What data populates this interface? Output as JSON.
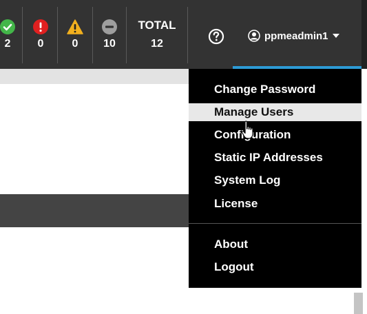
{
  "status": {
    "ok": {
      "icon": "check-circle-icon",
      "count": "2",
      "color": "#43b649"
    },
    "critical": {
      "icon": "exclamation-circle-icon",
      "count": "0",
      "color": "#e02020"
    },
    "warning": {
      "icon": "warning-triangle-icon",
      "count": "0",
      "color": "#f2b01e"
    },
    "disabled": {
      "icon": "minus-circle-icon",
      "count": "10",
      "color": "#9e9e9e"
    },
    "total": {
      "label": "TOTAL",
      "count": "12"
    }
  },
  "header": {
    "help_icon": "question-circle-icon",
    "user_icon": "user-circle-icon",
    "username": "ppmeadmin1",
    "accent_color": "#2d9bd6"
  },
  "user_menu": {
    "items": [
      {
        "label": "Change Password"
      },
      {
        "label": "Manage Users",
        "hovered": true
      },
      {
        "label": "Configuration"
      },
      {
        "label": "Static IP Addresses"
      },
      {
        "label": "System Log"
      },
      {
        "label": "License"
      }
    ],
    "secondary_items": [
      {
        "label": "About"
      },
      {
        "label": "Logout"
      }
    ]
  }
}
